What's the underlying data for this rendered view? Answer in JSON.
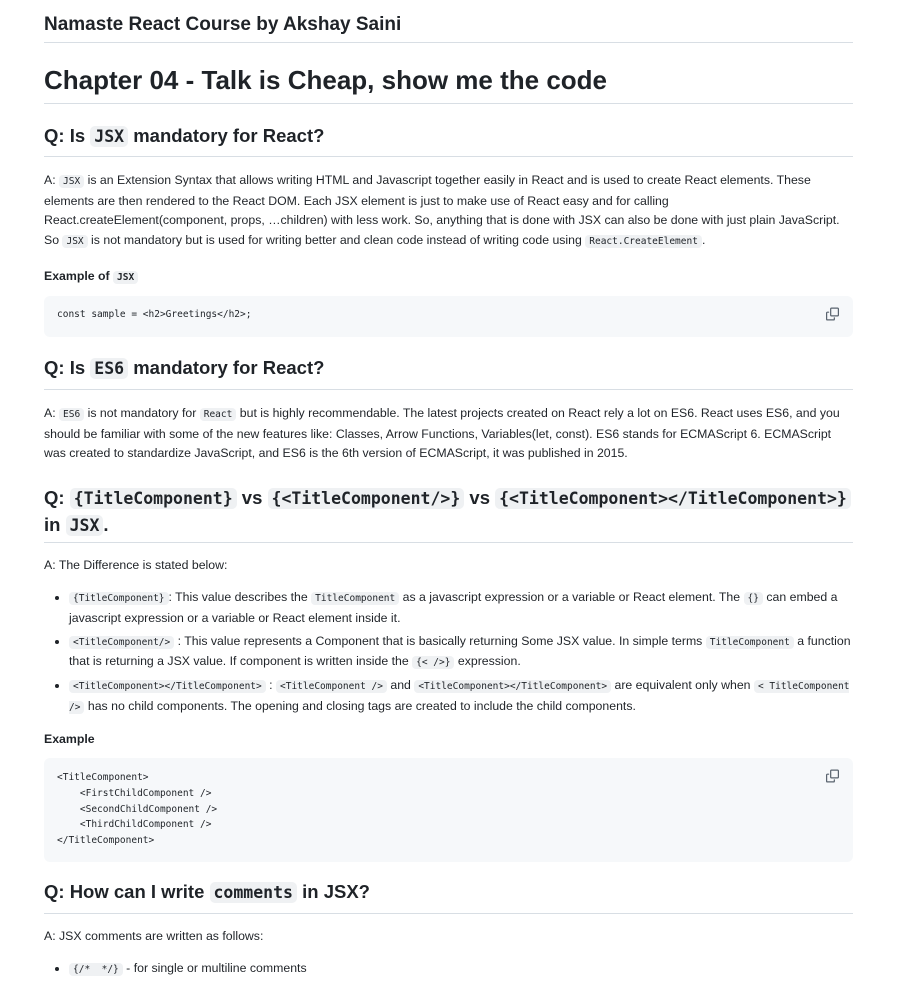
{
  "doc_title": "Namaste React Course by Akshay Saini",
  "chapter_title": "Chapter 04 - Talk is Cheap, show me the code",
  "q1": {
    "q_prefix": "Q: Is ",
    "q_code": "JSX",
    "q_suffix": " mandatory for React?",
    "a_prefix": "A: ",
    "a_code1": "JSX",
    "a_text1": " is an Extension Syntax that allows writing HTML and Javascript together easily in React and is used to create React elements. These elements are then rendered to the React DOM. Each JSX element is just to make use of React easy and for calling React.createElement(component, props, …children) with less work. So, anything that is done with JSX can also be done with just plain JavaScript. So ",
    "a_code2": "JSX",
    "a_text2": " is not mandatory but is used for writing better and clean code instead of writing code using ",
    "a_code3": "React.CreateElement",
    "a_text3": ".",
    "example_label": "Example of ",
    "example_code": "JSX",
    "code": "const sample = <h2>Greetings</h2>;"
  },
  "q2": {
    "q_prefix": "Q: Is ",
    "q_code": "ES6",
    "q_suffix": " mandatory for React?",
    "a_prefix": "A: ",
    "a_code1": "ES6",
    "a_text1": " is not mandatory for ",
    "a_code2": "React",
    "a_text2": " but is highly recommendable. The latest projects created on React rely a lot on ES6. React uses ES6, and you should be familiar with some of the new features like: Classes, Arrow Functions, Variables(let, const). ES6 stands for ECMAScript 6. ECMAScript was created to standardize JavaScript, and ES6 is the 6th version of ECMAScript, it was published in 2015."
  },
  "q3": {
    "q_prefix": "Q: ",
    "q_code1": "{TitleComponent}",
    "q_vs1": " vs ",
    "q_code2": "{<TitleComponent/>}",
    "q_vs2": " vs ",
    "q_code3": "{<TitleComponent></TitleComponent>}",
    "q_in": " in ",
    "q_code4": "JSX",
    "q_end": ".",
    "answer": "A: The Difference is stated below:",
    "b1_code1": "{TitleComponent}",
    "b1_text1": ": This value describes the ",
    "b1_code2": "TitleComponent",
    "b1_text2": " as a javascript expression or a variable or React element. The ",
    "b1_code3": "{}",
    "b1_text3": " can embed a javascript expression or a variable or React element inside it.",
    "b2_code1": "<TitleComponent/>",
    "b2_text1": " : This value represents a Component that is basically returning Some JSX value. In simple terms ",
    "b2_code2": "TitleComponent",
    "b2_text2": " a function that is returning a JSX value. If component is written inside the ",
    "b2_code3": "{< />}",
    "b2_text3": " expression.",
    "b3_code1": "<TitleComponent></TitleComponent>",
    "b3_text1": " : ",
    "b3_code2": "<TitleComponent />",
    "b3_text2": " and ",
    "b3_code3": "<TitleComponent></TitleComponent>",
    "b3_text3": " are equivalent only when ",
    "b3_code4": "< TitleComponent />",
    "b3_text4": " has no child components. The opening and closing tags are created to include the child components.",
    "example_label": "Example",
    "code": "<TitleComponent>\n    <FirstChildComponent />\n    <SecondChildComponent />\n    <ThirdChildComponent />\n</TitleComponent>"
  },
  "q4": {
    "q_prefix": "Q: How can I write ",
    "q_code": "comments",
    "q_suffix": " in JSX?",
    "answer": "A: JSX comments are written as follows:",
    "b1_code": "{/*  */}",
    "b1_text": " - for single or multiline comments"
  }
}
